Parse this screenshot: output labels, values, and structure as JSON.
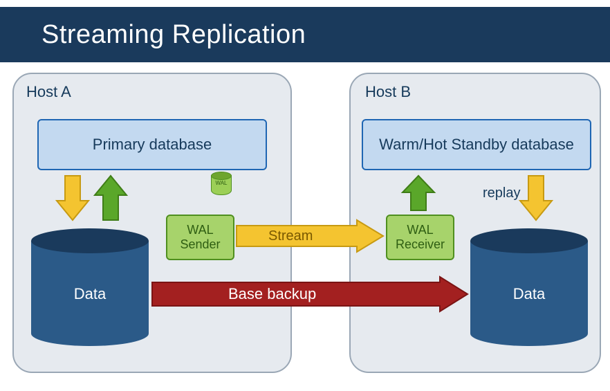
{
  "title": "Streaming Replication",
  "hosts": {
    "a": {
      "label": "Host A",
      "database_label": "Primary database",
      "data_cylinder": "Data"
    },
    "b": {
      "label": "Host B",
      "database_label": "Warm/Hot Standby database",
      "data_cylinder": "Data",
      "replay_label": "replay"
    }
  },
  "components": {
    "wal_sender": "WAL\nSender",
    "wal_receiver": "WAL\nReceiver",
    "wal_file": "WAL"
  },
  "flows": {
    "stream": "Stream",
    "base_backup": "Base backup"
  },
  "colors": {
    "title_bg": "#1a3a5c",
    "host_bg": "#e6eaef",
    "host_border": "#9aa7b5",
    "db_fill": "#c3d9f0",
    "db_border": "#1f66b3",
    "wal_fill": "#a7d36b",
    "wal_border": "#4f8f1f",
    "cylinder_body": "#2b5a88",
    "cylinder_top": "#1a3a5c",
    "yellow_arrow": "#f4c430",
    "yellow_stroke": "#c79a12",
    "green_arrow": "#5aa72a",
    "green_stroke": "#3f7d17",
    "red_arrow": "#a32020",
    "red_stroke": "#7a1414"
  }
}
